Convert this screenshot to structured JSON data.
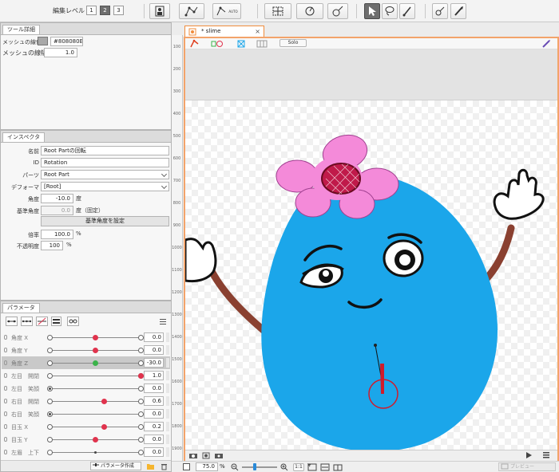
{
  "toolbar": {
    "edit_level_label": "編集レベル :",
    "edit_levels": [
      "1",
      "2",
      "3"
    ],
    "selected_level": "2",
    "auto_label": "AUTO"
  },
  "tool_detail": {
    "tab_label": "ツール詳細",
    "mesh_color_label": "メッシュの線色",
    "mesh_color_value": "#808080B0",
    "mesh_width_label": "メッシュの線幅",
    "mesh_width_value": "1.0"
  },
  "inspector": {
    "tab_label": "インスペクタ",
    "name_label": "名前",
    "name_value": "Root Partの回転",
    "id_label": "ID",
    "id_value": "Rotation",
    "parts_label": "パーツ",
    "parts_value": "Root Part",
    "deformer_label": "デフォーマ",
    "deformer_value": "[Root]",
    "angle_label": "角度",
    "angle_value": "-10.0",
    "angle_unit": "度",
    "base_angle_label": "基準角度",
    "base_angle_value": "0.0",
    "base_angle_unit": "度（固定）",
    "set_base_angle_button": "基準角度を設定",
    "scale_label": "倍率",
    "scale_value": "100.0",
    "scale_unit": "%",
    "opacity_label": "不透明度",
    "opacity_value": "100",
    "opacity_unit": "%"
  },
  "parameters": {
    "tab_label": "パラメータ",
    "rows": [
      {
        "name": "角度 X",
        "value": "0.0",
        "position": 0.5,
        "color": "#e0334d",
        "highlight": false
      },
      {
        "name": "角度 Y",
        "value": "0.0",
        "position": 0.5,
        "color": "#e0334d",
        "highlight": false
      },
      {
        "name": "角度 Z",
        "value": "-30.0",
        "position": 0.5,
        "color": "#3bb34a",
        "highlight": true
      },
      {
        "name": "左目　開閉",
        "value": "1.0",
        "position": 1.0,
        "color": "#e0334d",
        "highlight": false
      },
      {
        "name": "左目　笑顔",
        "value": "0.0",
        "position": 0.0,
        "color": "#444444",
        "highlight": false
      },
      {
        "name": "右目　開閉",
        "value": "0.6",
        "position": 0.6,
        "color": "#e0334d",
        "highlight": false
      },
      {
        "name": "右目　笑顔",
        "value": "0.0",
        "position": 0.0,
        "color": "#444444",
        "highlight": false
      },
      {
        "name": "目玉 X",
        "value": "0.2",
        "position": 0.6,
        "color": "#e0334d",
        "highlight": false
      },
      {
        "name": "目玉 Y",
        "value": "0.0",
        "position": 0.5,
        "color": "#e0334d",
        "highlight": false
      },
      {
        "name": "左眉　上下",
        "value": "0.0",
        "position": 0.5,
        "color": "#444444",
        "highlight": false
      }
    ],
    "create_button": "パラメータ作成"
  },
  "document": {
    "tab_title": "* slime",
    "solo_label": "Solo"
  },
  "ruler": {
    "ticks": [
      "100",
      "200",
      "300",
      "400",
      "500",
      "600",
      "700",
      "800",
      "900",
      "1000",
      "1100",
      "1200",
      "1300",
      "1400",
      "1500",
      "1600",
      "1700",
      "1800",
      "1900"
    ]
  },
  "statusbar": {
    "zoom_value": "75.0",
    "zoom_unit": "%",
    "ratio_label": "1:1",
    "preview_label": "プレビュー"
  },
  "colors": {
    "accent_orange": "#f08c3c",
    "slime_blue": "#1ba6ea",
    "flower_pink": "#f48ad9",
    "flower_center": "#c01a4a",
    "arm_brown": "#8a4030"
  }
}
